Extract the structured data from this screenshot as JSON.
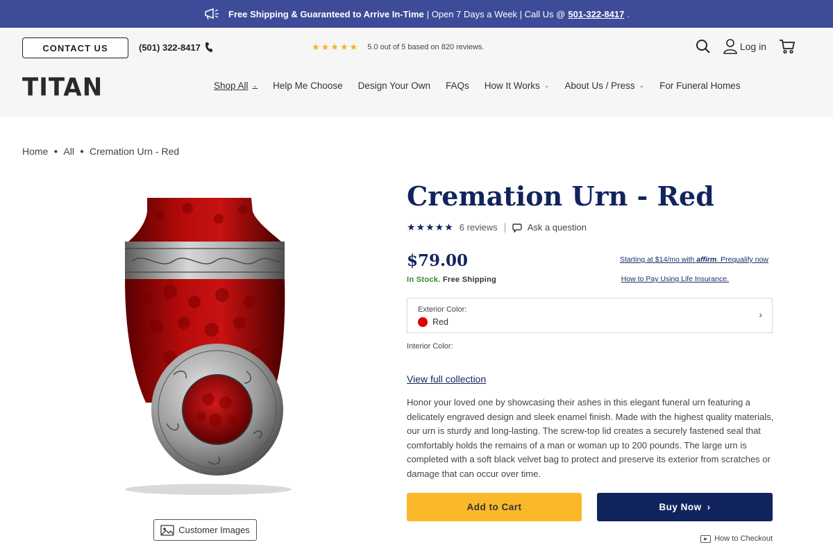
{
  "announcement": {
    "bold_text": "Free Shipping & Guaranteed to Arrive In-Time",
    "text": "| Open 7 Days a Week | Call Us @",
    "phone": "501-322-8417",
    "trailing": "."
  },
  "utility": {
    "contact_label": "CONTACT US",
    "phone": "(501) 322-8417",
    "stars": "★★★★★",
    "rating_text": "5.0 out of 5 based on 820 reviews.",
    "login_label": "Log in"
  },
  "nav": {
    "logo": "TITAN",
    "items": [
      {
        "label": "Shop All",
        "has_dropdown": true
      },
      {
        "label": "Help Me Choose",
        "has_dropdown": false
      },
      {
        "label": "Design Your Own",
        "has_dropdown": false
      },
      {
        "label": "FAQs",
        "has_dropdown": false
      },
      {
        "label": "How It Works",
        "has_dropdown": true
      },
      {
        "label": "About Us / Press",
        "has_dropdown": true
      },
      {
        "label": "For Funeral Homes",
        "has_dropdown": false
      }
    ]
  },
  "breadcrumb": [
    "Home",
    "All",
    "Cremation Urn - Red"
  ],
  "product": {
    "title": "Cremation Urn - Red",
    "stars": "★★★★★",
    "reviews": "6 reviews",
    "ask_question": "Ask a question",
    "price": "$79.00",
    "stock": "In Stock.",
    "shipping": "Free Shipping",
    "affirm_prefix": "Starting at $14/mo with",
    "affirm_logo": "affirm",
    "affirm_suffix": ". Prequalify now",
    "life_insurance": "How to Pay Using Life Insurance.",
    "exterior_label": "Exterior Color:",
    "exterior_value": "Red",
    "interior_label": "Interior Color:",
    "view_collection": "View full collection",
    "description": "Honor your loved one by showcasing their ashes in this elegant funeral urn featuring a delicately engraved design and sleek enamel finish. Made with the highest quality materials, our urn is sturdy and long-lasting. The screw-top lid creates a securely fastened seal that comfortably holds the remains of a man or woman up to 200 pounds. The large urn is completed with a soft black velvet bag to protect and preserve its exterior from scratches or damage that can occur over time.",
    "add_to_cart": "Add to Cart",
    "buy_now": "Buy Now",
    "how_to_checkout": "How to Checkout",
    "customer_images": "Customer Images"
  },
  "colors": {
    "announce_bg": "#3d4b99",
    "navy": "#12245e",
    "gold": "#fbb82a",
    "swatch_red": "#e00000",
    "in_stock_green": "#2d8a2d"
  }
}
